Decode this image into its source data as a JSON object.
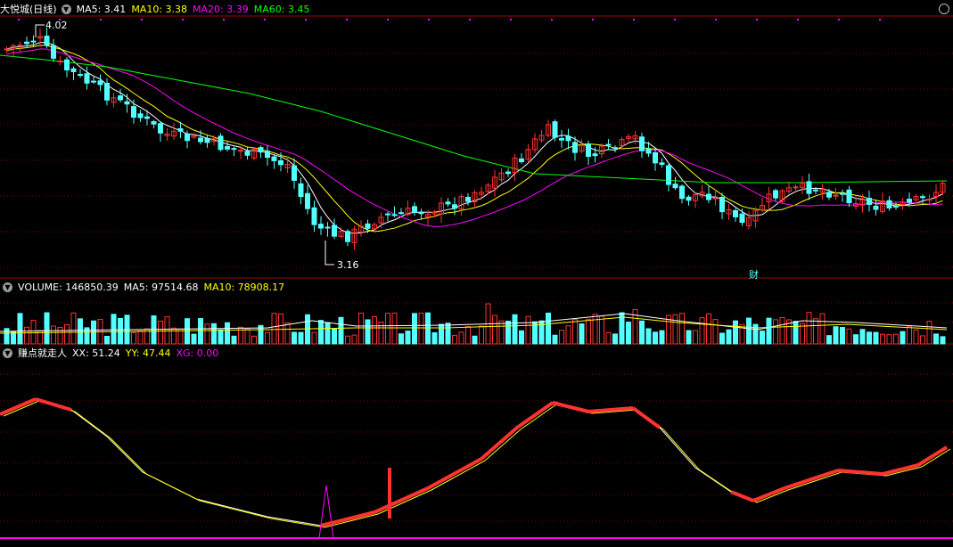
{
  "main": {
    "title": "大悦城(日线)",
    "ma5": "MA5: 3.41",
    "ma10": "MA10: 3.38",
    "ma20": "MA20: 3.39",
    "ma60": "MA60: 3.45",
    "high_label": "4.02",
    "low_label": "3.16",
    "finance_marker": "财"
  },
  "volume": {
    "title": "VOLUME: 146850.39",
    "ma5": "MA5: 97514.68",
    "ma10": "MA10: 78908.17"
  },
  "indicator": {
    "title": "赚点就走人",
    "xx": "XX: 51.24",
    "yy": "YY: 47.44",
    "xg": "XG: 0.00"
  },
  "colors": {
    "up": "#ff3232",
    "down": "#54ffff",
    "ma5": "#ffffff",
    "ma10": "#ffff00",
    "ma20": "#ff00ff",
    "ma60": "#00ff00",
    "grid": "#7a0000",
    "frame": "#a00000"
  },
  "icons": [
    "collapse-icon",
    "window-circle-icon"
  ]
}
